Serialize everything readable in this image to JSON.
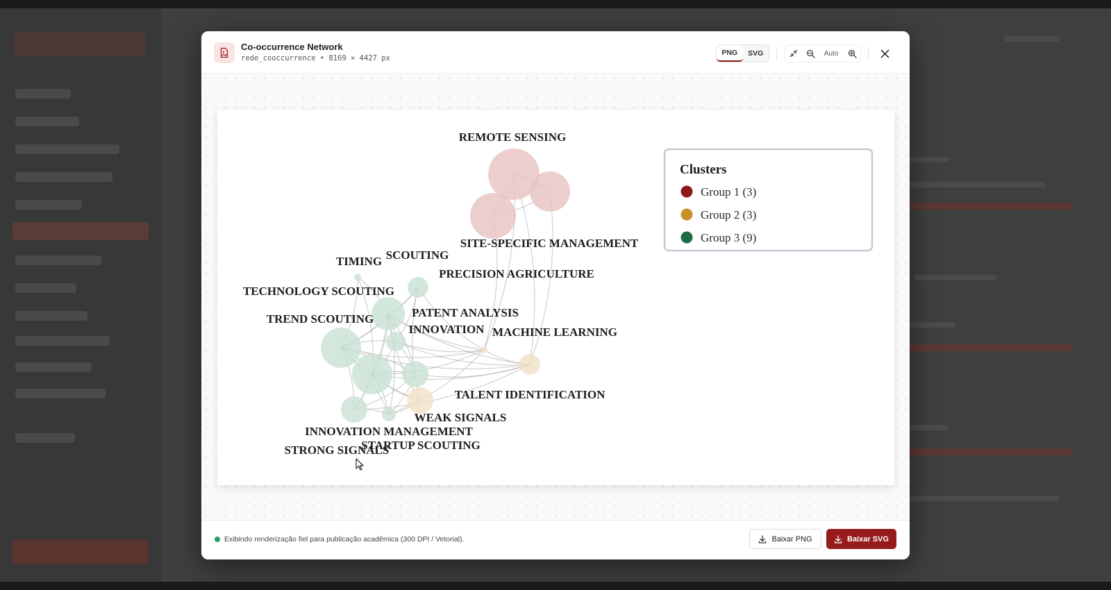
{
  "modal": {
    "title": "Co-occurrence Network",
    "subtitle": "rede_cooccurrence • 8169 × 4427 px",
    "format_png": "PNG",
    "format_svg": "SVG",
    "active_format": "PNG",
    "zoom_label": "Auto"
  },
  "footer": {
    "status_text": "Exibindo renderização fiel para publicação acadêmica (300 DPI / Vetorial).",
    "download_png": "Baixar PNG",
    "download_svg": "Baixar SVG"
  },
  "colors": {
    "accent": "#961c1c",
    "status_ok": "#27a36a",
    "group1": "#8b1a1a",
    "group2": "#c98d2a",
    "group3": "#1f6b42"
  },
  "icons": [
    "file-image-icon",
    "collapse-icon",
    "zoom-out-icon",
    "zoom-in-icon",
    "close-icon",
    "download-icon",
    "cursor-icon"
  ],
  "chart_data": {
    "type": "network",
    "legend": {
      "title": "Clusters",
      "placement": "top-right",
      "entries": [
        {
          "label": "Group 1 (3)",
          "color": "#8b1a1a"
        },
        {
          "label": "Group 2 (3)",
          "color": "#c98d2a"
        },
        {
          "label": "Group 3 (9)",
          "color": "#1f6b42"
        }
      ]
    },
    "nodes": [
      {
        "label": "REMOTE SENSING",
        "group": 1
      },
      {
        "label": "SITE-SPECIFIC MANAGEMENT",
        "group": 1
      },
      {
        "label": "PRECISION AGRICULTURE",
        "group": 1
      },
      {
        "label": "MACHINE LEARNING",
        "group": 2
      },
      {
        "label": "TALENT IDENTIFICATION",
        "group": 2
      },
      {
        "label": "INNOVATION",
        "group": 2
      },
      {
        "label": "TIMING",
        "group": 3
      },
      {
        "label": "SCOUTING",
        "group": 3
      },
      {
        "label": "TECHNOLOGY SCOUTING",
        "group": 3
      },
      {
        "label": "TREND SCOUTING",
        "group": 3
      },
      {
        "label": "PATENT ANALYSIS",
        "group": 3
      },
      {
        "label": "WEAK SIGNALS",
        "group": 3
      },
      {
        "label": "INNOVATION MANAGEMENT",
        "group": 3
      },
      {
        "label": "STARTUP SCOUTING",
        "group": 3
      },
      {
        "label": "STRONG SIGNALS",
        "group": 3
      }
    ]
  }
}
